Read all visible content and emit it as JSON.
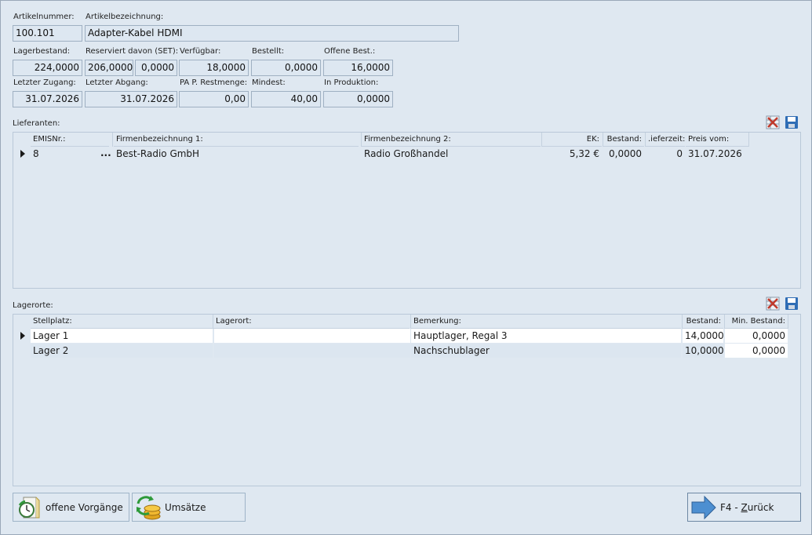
{
  "article": {
    "number_label": "Artikelnummer:",
    "number_value": "100.101",
    "name_label": "Artikelbezeichnung:",
    "name_value": "Adapter-Kabel HDMI"
  },
  "stock": {
    "lagerbestand_label": "Lagerbestand:",
    "lagerbestand_value": "224,0000",
    "reserviert_label": "Reserviert davon (SET):",
    "reserviert_value": "206,0000",
    "set_value": "0,0000",
    "verfuegbar_label": "Verfügbar:",
    "verfuegbar_value": "18,0000",
    "bestellt_label": "Bestellt:",
    "bestellt_value": "0,0000",
    "offene_label": "Offene Best.:",
    "offene_value": "16,0000",
    "zugang_label": "Letzter Zugang:",
    "zugang_value": "31.07.2026",
    "abgang_label": "Letzter Abgang:",
    "abgang_value": "31.07.2026",
    "pap_label": "PA P. Restmenge:",
    "pap_value": "0,00",
    "mindest_label": "Mindest:",
    "mindest_value": "40,00",
    "produktion_label": "In Produktion:",
    "produktion_value": "0,0000"
  },
  "lieferanten": {
    "title": "Lieferanten:",
    "headers": {
      "emis": "EMISNr.:",
      "firma1": "Firmenbezeichnung 1:",
      "firma2": "Firmenbezeichnung 2:",
      "ek": "EK:",
      "bestand": "Bestand:",
      "lieferzeit": ".ieferzeit:",
      "preis": "Preis vom:"
    },
    "rows": [
      {
        "emis": "8",
        "dots": "...",
        "firma1": "Best-Radio GmbH",
        "firma2": "Radio Großhandel",
        "ek": "5,32 €",
        "bestand": "0,0000",
        "lieferzeit": "0",
        "preis": "31.07.2026"
      }
    ]
  },
  "lagerorte": {
    "title": "Lagerorte:",
    "headers": {
      "stellplatz": "Stellplatz:",
      "lagerort": "Lagerort:",
      "bemerkung": "Bemerkung:",
      "bestand": "Bestand:",
      "min": "Min. Bestand:"
    },
    "rows": [
      {
        "stellplatz": "Lager 1",
        "lagerort": "",
        "bemerkung": "Hauptlager, Regal 3",
        "bestand": "14,0000",
        "min": "0,0000"
      },
      {
        "stellplatz": "Lager 2",
        "lagerort": "",
        "bemerkung": "Nachschublager",
        "bestand": "10,0000",
        "min": "0,0000"
      }
    ]
  },
  "buttons": {
    "offene_vorgaenge": "offene Vorgänge",
    "umsaetze": "Umsätze",
    "zurueck_prefix": "F4 - ",
    "zurueck_underline": "Z",
    "zurueck_rest": "urück"
  },
  "colors": {
    "background": "#dfe8f1",
    "field": "#dde7f1",
    "arrow": "#4d8fd1",
    "delete_red": "#c0392b",
    "save_blue": "#2f6db5"
  },
  "icons": {
    "delete": "delete-icon",
    "save": "save-icon",
    "clock": "clock-icon",
    "coins": "coins-icon",
    "arrow": "arrow-right-icon"
  }
}
